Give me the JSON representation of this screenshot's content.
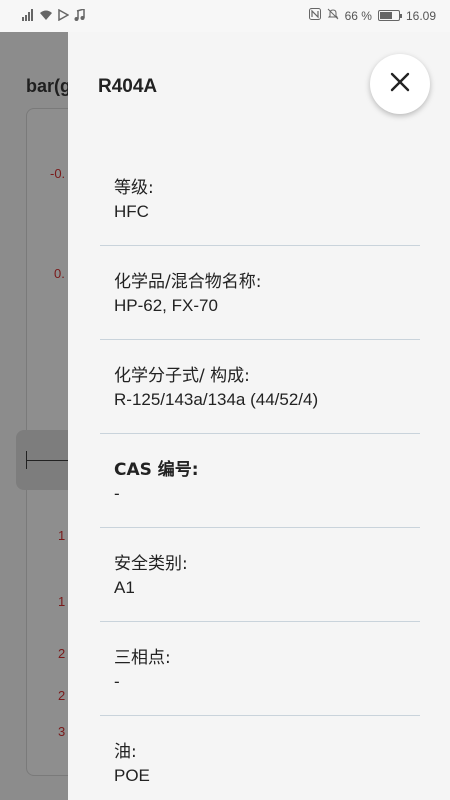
{
  "status_bar": {
    "battery_percent": "66 %",
    "battery_level": 0.66,
    "time": "16.09",
    "icons": [
      "signal-icon",
      "wifi-icon",
      "play-store-icon",
      "music-icon",
      "nfc-icon",
      "mute-icon",
      "battery-icon"
    ]
  },
  "background": {
    "title": "bar(g",
    "scale_labels": [
      "-0.",
      "0.",
      "1",
      "1",
      "2",
      "2",
      "3"
    ]
  },
  "drawer": {
    "title": "R404A",
    "items": [
      {
        "label": "等级:",
        "value": "HFC",
        "bold": false
      },
      {
        "label": "化学品/混合物名称:",
        "value": "HP-62, FX-70",
        "bold": false
      },
      {
        "label": "化学分子式/ 构成:",
        "value": "R-125/143a/134a (44/52/4)",
        "bold": false
      },
      {
        "label": "CAS 编号:",
        "value": "-",
        "bold": true
      },
      {
        "label": "安全类别:",
        "value": "A1",
        "bold": false
      },
      {
        "label": "三相点:",
        "value": "-",
        "bold": false
      },
      {
        "label": "油:",
        "value": "POE",
        "bold": false
      }
    ]
  },
  "colors": {
    "overlay": "#8a8a8a",
    "drawer_bg": "#f5f5f5",
    "divider": "#c9d3db",
    "scale_text": "#7a1a1a"
  }
}
